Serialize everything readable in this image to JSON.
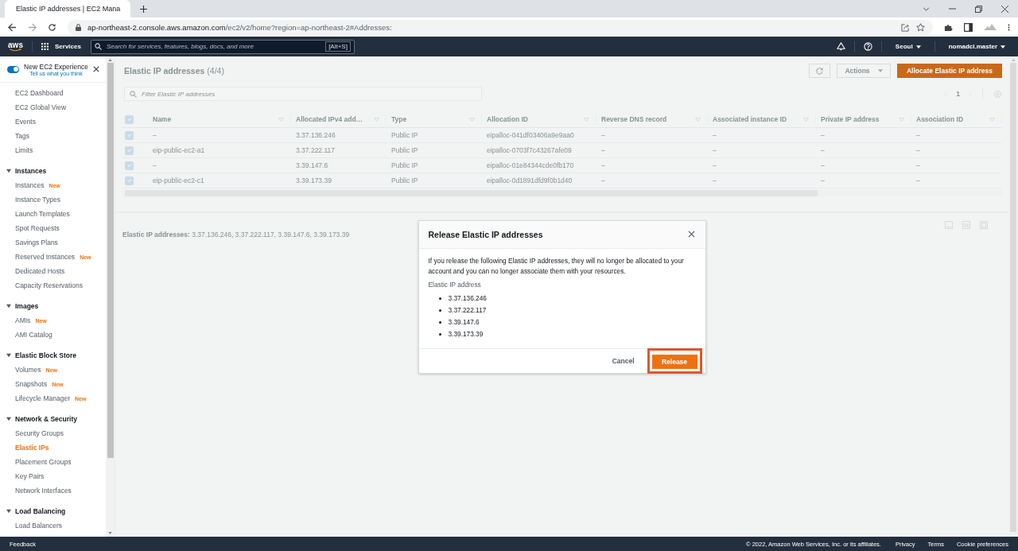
{
  "browser": {
    "tab": {
      "title": "Elastic IP addresses | EC2 Mana"
    },
    "url": {
      "host": "ap-northeast-2.console.aws.amazon.com",
      "path": "/ec2/v2/home?region=ap-northeast-2#Addresses:"
    }
  },
  "topnav": {
    "logo": "aws",
    "services": "Services",
    "search": {
      "placeholder": "Search for services, features, blogs, docs, and more",
      "shortcut": "[Alt+S]"
    },
    "region": "Seoul",
    "account": "nomadcl.master"
  },
  "sidebar": {
    "experience_toggle": {
      "label": "New EC2 Experience",
      "on": true,
      "link": "Tell us what you think"
    },
    "sections": [
      {
        "items": [
          {
            "label": "EC2 Dashboard",
            "selected": false
          },
          {
            "label": "EC2 Global View",
            "selected": false
          },
          {
            "label": "Events",
            "selected": false
          },
          {
            "label": "Tags",
            "selected": false
          },
          {
            "label": "Limits",
            "selected": false
          }
        ]
      },
      {
        "title": "Instances",
        "expanded": true,
        "items": [
          {
            "label": "Instances",
            "badge": "New",
            "selected": false
          },
          {
            "label": "Instance Types",
            "selected": false
          },
          {
            "label": "Launch Templates",
            "selected": false
          },
          {
            "label": "Spot Requests",
            "selected": false
          },
          {
            "label": "Savings Plans",
            "selected": false
          },
          {
            "label": "Reserved Instances",
            "badge": "New",
            "selected": false
          },
          {
            "label": "Dedicated Hosts",
            "selected": false
          },
          {
            "label": "Capacity Reservations",
            "selected": false
          }
        ]
      },
      {
        "title": "Images",
        "expanded": true,
        "items": [
          {
            "label": "AMIs",
            "badge": "New",
            "selected": false
          },
          {
            "label": "AMI Catalog",
            "selected": false
          }
        ]
      },
      {
        "title": "Elastic Block Store",
        "expanded": true,
        "items": [
          {
            "label": "Volumes",
            "badge": "New",
            "selected": false
          },
          {
            "label": "Snapshots",
            "badge": "New",
            "selected": false
          },
          {
            "label": "Lifecycle Manager",
            "badge": "New",
            "selected": false
          }
        ]
      },
      {
        "title": "Network & Security",
        "expanded": true,
        "items": [
          {
            "label": "Security Groups",
            "selected": false
          },
          {
            "label": "Elastic IPs",
            "selected": true
          },
          {
            "label": "Placement Groups",
            "selected": false
          },
          {
            "label": "Key Pairs",
            "selected": false
          },
          {
            "label": "Network Interfaces",
            "selected": false
          }
        ]
      },
      {
        "title": "Load Balancing",
        "expanded": true,
        "items": [
          {
            "label": "Load Balancers",
            "selected": false
          }
        ]
      }
    ]
  },
  "main": {
    "title": "Elastic IP addresses",
    "count": "(4/4)",
    "actions": "Actions",
    "allocate": "Allocate Elastic IP address",
    "filter": {
      "placeholder": "Filter Elastic IP addresses"
    },
    "page": "1",
    "table": {
      "all_checked": true,
      "columns": [
        "Name",
        "Allocated IPv4 add…",
        "Type",
        "Allocation ID",
        "Reverse DNS record",
        "Associated instance ID",
        "Private IP address",
        "Association ID"
      ],
      "rows": [
        {
          "checked": true,
          "cells": [
            "–",
            "3.37.136.246",
            "Public IP",
            "eipalloc-041df03406a9e9aa0",
            "–",
            "–",
            "–",
            "–"
          ]
        },
        {
          "checked": true,
          "cells": [
            "eip-public-ec2-a1",
            "3.37.222.117",
            "Public IP",
            "eipalloc-0703f7c43267afe09",
            "–",
            "–",
            "–",
            "–"
          ]
        },
        {
          "checked": true,
          "cells": [
            "–",
            "3.39.147.6",
            "Public IP",
            "eipalloc-01e84344cde0fb170",
            "–",
            "–",
            "–",
            "–"
          ]
        },
        {
          "checked": true,
          "cells": [
            "eip-public-ec2-c1",
            "3.39.173.39",
            "Public IP",
            "eipalloc-0d1891dfd9f0b1d40",
            "–",
            "–",
            "–",
            "–"
          ]
        }
      ]
    },
    "summary": "**Elastic IP addresses:** 3.37.136.246, 3.37.222.117, 3.39.147.6, 3.39.173.39"
  },
  "modal": {
    "title": "Release Elastic IP addresses",
    "message": "If you release the following Elastic IP addresses, they will no longer be allocated to your account and you can no longer associate them with your resources.",
    "list_label": "Elastic IP address",
    "addresses": [
      "3.37.136.246",
      "3.37.222.117",
      "3.39.147.6",
      "3.39.173.39"
    ],
    "cancel": "Cancel",
    "release": "Release",
    "release_highlighted": true
  },
  "footer": {
    "feedback": "Feedback",
    "copyright": "© 2022, Amazon Web Services, Inc. or its affiliates.",
    "links": [
      "Privacy",
      "Terms",
      "Cookie preferences"
    ]
  }
}
